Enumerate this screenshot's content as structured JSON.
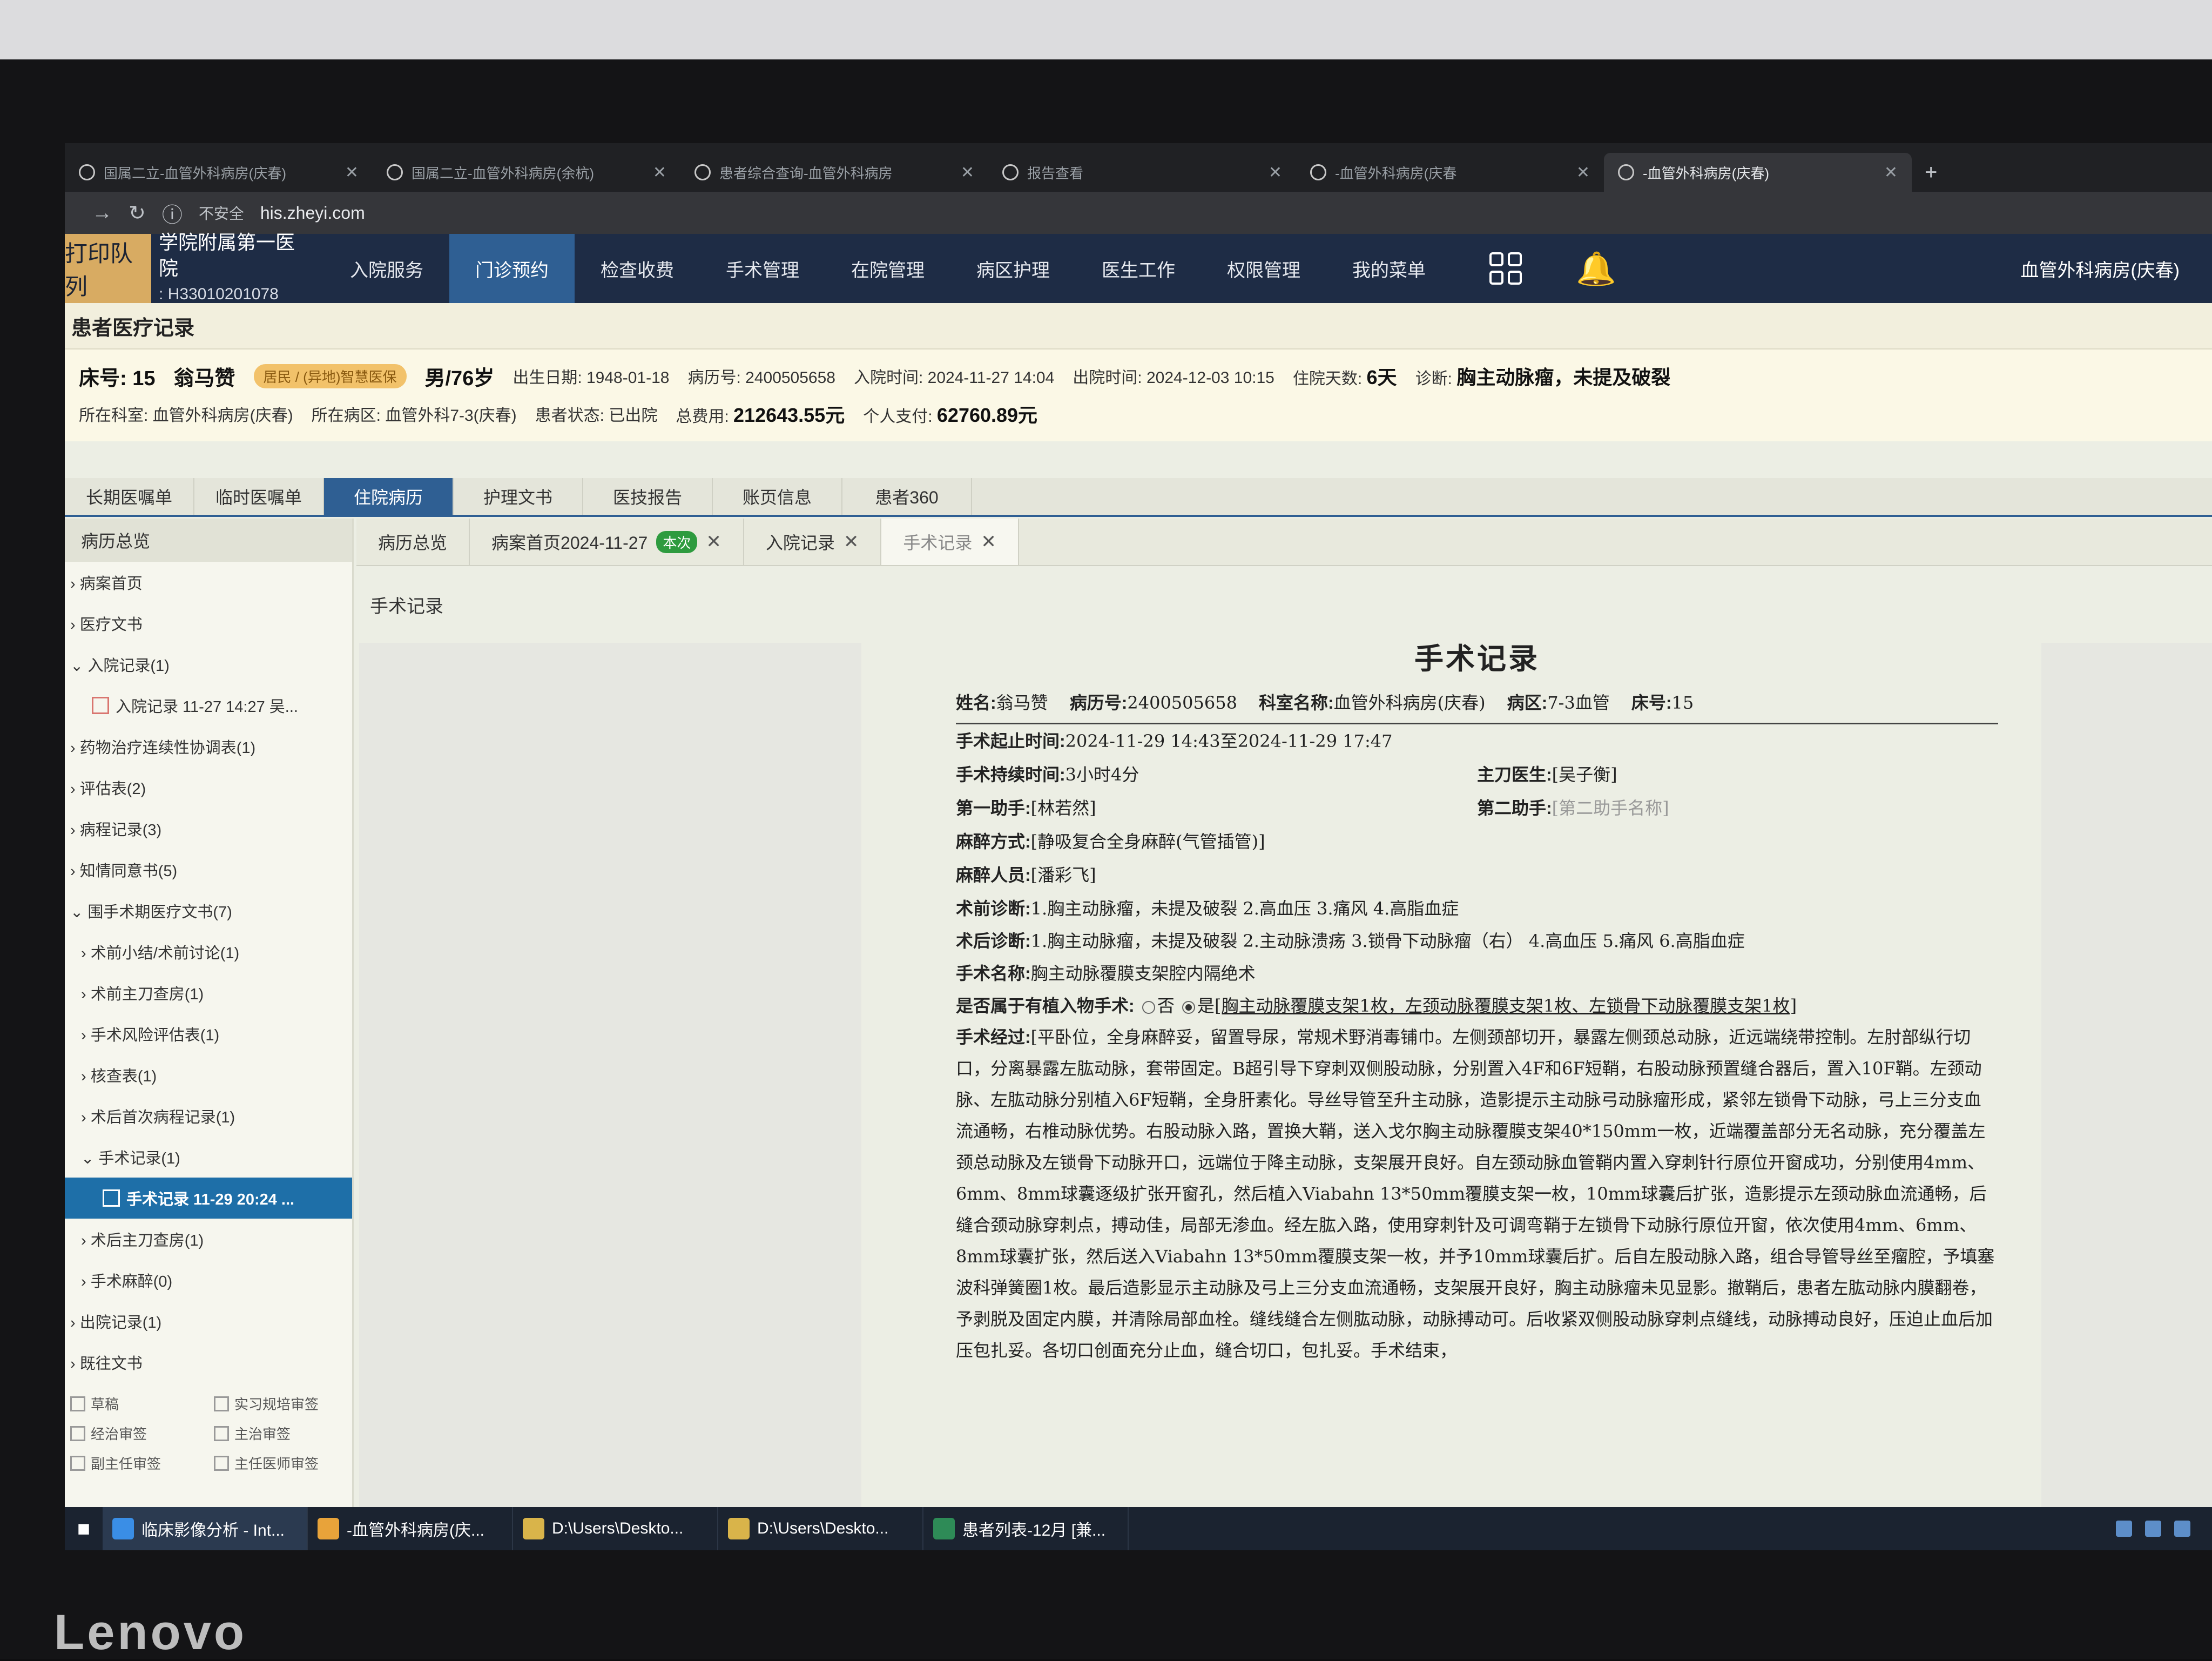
{
  "browser": {
    "tabs": [
      {
        "title": "国属二立-血管外科病房(庆春)"
      },
      {
        "title": "国属二立-血管外科病房(余杭)"
      },
      {
        "title": "患者综合查询-血管外科病房"
      },
      {
        "title": "报告查看"
      },
      {
        "title": "-血管外科病房(庆春"
      },
      {
        "title": "-血管外科病房(庆春)"
      }
    ],
    "new_tab": "+",
    "unsafe": "不安全",
    "url": "his.zheyi.com"
  },
  "app": {
    "print_queue": "打印队列",
    "hospital": "学院附属第一医院",
    "hospital_code": ": H33010201078",
    "nav": [
      "入院服务",
      "门诊预约",
      "检查收费",
      "手术管理",
      "在院管理",
      "病区护理",
      "医生工作",
      "权限管理",
      "我的菜单"
    ],
    "dept": "血管外科病房(庆春)"
  },
  "page_title": "患者医疗记录",
  "patient": {
    "bed": "床号: 15",
    "name": "翁马赞",
    "insurance": "居民 / (异地)智慧医保",
    "gender_age": "男/76岁",
    "birth": "出生日期: 1948-01-18",
    "record_no": "病历号: 2400505658",
    "admit": "入院时间: 2024-11-27 14:04",
    "discharge": "出院时间: 2024-12-03 10:15",
    "days_label": "住院天数:",
    "days": "6天",
    "diag_label": "诊断:",
    "diag": "胸主动脉瘤，未提及破裂",
    "dept": "所在科室: 血管外科病房(庆春)",
    "ward": "所在病区: 血管外科7-3(庆春)",
    "status": "患者状态: 已出院",
    "total_label": "总费用:",
    "total": "212643.55元",
    "self_label": "个人支付:",
    "self": "62760.89元"
  },
  "main_tabs": [
    "长期医嘱单",
    "临时医嘱单",
    "住院病历",
    "护理文书",
    "医技报告",
    "账页信息",
    "患者360"
  ],
  "sidebar": {
    "header": "病历总览",
    "items": [
      {
        "label": "› 病案首页"
      },
      {
        "label": "› 医疗文书"
      },
      {
        "label": "⌄ 入院记录(1)"
      },
      {
        "label": "入院记录 11-27 14:27 吴..."
      },
      {
        "label": "› 药物治疗连续性协调表(1)"
      },
      {
        "label": "› 评估表(2)"
      },
      {
        "label": "› 病程记录(3)"
      },
      {
        "label": "› 知情同意书(5)"
      },
      {
        "label": "⌄ 围手术期医疗文书(7)"
      },
      {
        "label": "› 术前小结/术前讨论(1)"
      },
      {
        "label": "› 术前主刀查房(1)"
      },
      {
        "label": "› 手术风险评估表(1)"
      },
      {
        "label": "› 核查表(1)"
      },
      {
        "label": "› 术后首次病程记录(1)"
      },
      {
        "label": "⌄ 手术记录(1)"
      },
      {
        "label": "手术记录 11-29 20:24 ..."
      },
      {
        "label": "› 术后主刀查房(1)"
      },
      {
        "label": "› 手术麻醉(0)"
      },
      {
        "label": "› 出院记录(1)"
      },
      {
        "label": "› 既往文书"
      }
    ],
    "legend": [
      "草稿",
      "实习规培审签",
      "经治审签",
      "主治审签",
      "副主任审签",
      "主任医师审签"
    ]
  },
  "doc_tabs": [
    {
      "label": "病历总览"
    },
    {
      "label": "病案首页2024-11-27",
      "badge": "本次"
    },
    {
      "label": "入院记录"
    },
    {
      "label": "手术记录"
    }
  ],
  "close_glyph": "✕",
  "crumb": "手术记录",
  "record": {
    "title": "手术记录",
    "name_l": "姓名:",
    "name": "翁马赞",
    "no_l": "病历号:",
    "no": "2400505658",
    "dept_l": "科室名称:",
    "dept": "血管外科病房(庆春)",
    "ward_l": "病区:",
    "ward": "7-3血管",
    "bed_l": "床号:",
    "bed": "15",
    "time_l": "手术起止时间:",
    "time": "2024-11-29 14:43至2024-11-29 17:47",
    "dur_l": "手术持续时间:",
    "dur": "3小时4分",
    "surgeon_l": "主刀医生:",
    "surgeon": "[吴子衡]",
    "a1_l": "第一助手:",
    "a1": "[林若然]",
    "a2_l": "第二助手:",
    "a2": "[第二助手名称]",
    "anes_l": "麻醉方式:",
    "anes": "[静吸复合全身麻醉(气管插管)]",
    "anesp_l": "麻醉人员:",
    "anesp": "[潘彩飞]",
    "pre_l": "术前诊断:",
    "pre": "1.胸主动脉瘤，未提及破裂 2.高血压 3.痛风 4.高脂血症",
    "post_l": "术后诊断:",
    "post": "1.胸主动脉瘤，未提及破裂 2.主动脉溃疡 3.锁骨下动脉瘤（右） 4.高血压 5.痛风 6.高脂血症",
    "op_l": "手术名称:",
    "op": "胸主动脉覆膜支架腔内隔绝术",
    "imp_l": "是否属于有植入物手术:",
    "imp_no": "否",
    "imp_yes": "是",
    "imp": "[胸主动脉覆膜支架1枚，左颈动脉覆膜支架1枚、左锁骨下动脉覆膜支架1枚]",
    "proc_l": "手术经过:",
    "proc": "[平卧位，全身麻醉妥，留置导尿，常规术野消毒铺巾。左侧颈部切开，暴露左侧颈总动脉，近远端绕带控制。左肘部纵行切口，分离暴露左肱动脉，套带固定。B超引导下穿刺双侧股动脉，分别置入4F和6F短鞘，右股动脉预置缝合器后，置入10F鞘。左颈动脉、左肱动脉分别植入6F短鞘，全身肝素化。导丝导管至升主动脉，造影提示主动脉弓动脉瘤形成，紧邻左锁骨下动脉，弓上三分支血流通畅，右椎动脉优势。右股动脉入路，置换大鞘，送入戈尔胸主动脉覆膜支架40*150mm一枚，近端覆盖部分无名动脉，充分覆盖左颈总动脉及左锁骨下动脉开口，远端位于降主动脉，支架展开良好。自左颈动脉血管鞘内置入穿刺针行原位开窗成功，分别使用4mm、6mm、8mm球囊逐级扩张开窗孔，然后植入Viabahn 13*50mm覆膜支架一枚，10mm球囊后扩张，造影提示左颈动脉血流通畅，后缝合颈动脉穿刺点，搏动佳，局部无渗血。经左肱入路，使用穿刺针及可调弯鞘于左锁骨下动脉行原位开窗，依次使用4mm、6mm、8mm球囊扩张，然后送入Viabahn 13*50mm覆膜支架一枚，并予10mm球囊后扩。后自左股动脉入路，组合导管导丝至瘤腔，予填塞波科弹簧圈1枚。最后造影显示主动脉及弓上三分支血流通畅，支架展开良好，胸主动脉瘤未见显影。撤鞘后，患者左肱动脉内膜翻卷，予剥脱及固定内膜，并清除局部血栓。缝线缝合左侧肱动脉，动脉搏动可。后收紧双侧股动脉穿刺点缝线，动脉搏动良好，压迫止血后加压包扎妥。各切口创面充分止血，缝合切口，包扎妥。手术结束，"
  },
  "taskbar": [
    {
      "label": "临床影像分析 - Int...",
      "color": "#3a8ee6"
    },
    {
      "label": "-血管外科病房(庆...",
      "color": "#e8a33a"
    },
    {
      "label": "D:\\Users\\Deskto...",
      "color": "#d9b44a"
    },
    {
      "label": "D:\\Users\\Deskto...",
      "color": "#d9b44a"
    },
    {
      "label": "患者列表-12月  [兼...",
      "color": "#2e8b57"
    }
  ],
  "brand": "Lenovo",
  "colors": {
    "nav_bg": "#1e2c45",
    "accent": "#2f5f93",
    "selected": "#1e6fa8",
    "badge": "#2e9b3f"
  }
}
